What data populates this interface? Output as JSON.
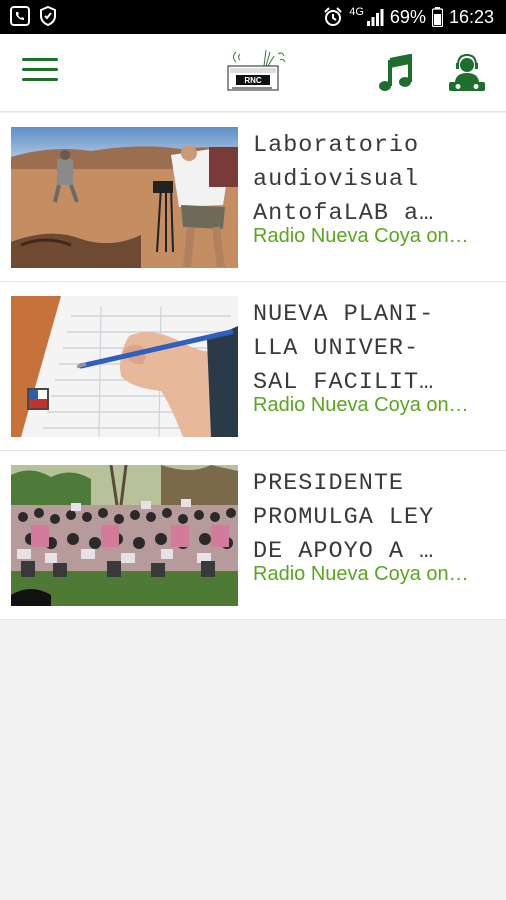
{
  "status_bar": {
    "left_icons": [
      "whatsapp-icon",
      "shield-icon"
    ],
    "right_icons": [
      "alarm-icon",
      "signal-4g-icon",
      "battery-icon"
    ],
    "network": "4G",
    "battery": "69%",
    "time": "16:23"
  },
  "app_bar": {
    "menu_icon": "hamburger-menu-icon",
    "logo_text": "RNC",
    "music_icon": "music-note-icon",
    "dj_icon": "dj-icon"
  },
  "articles": [
    {
      "title": "Laboratorio\naudiovisual\nAntofaLAB a…",
      "source": "Radio Nueva Coya on…"
    },
    {
      "title": "NUEVA PLANI-\nLLA UNIVER-\nSAL FACILIT…",
      "source": "Radio Nueva Coya on…"
    },
    {
      "title": "PRESIDENTE\nPROMULGA LEY\nDE APOYO A …",
      "source": "Radio Nueva Coya on…"
    }
  ],
  "colors": {
    "brand_green": "#1e6e2e",
    "source_green": "#5aa620",
    "status_bar": "#000000"
  }
}
